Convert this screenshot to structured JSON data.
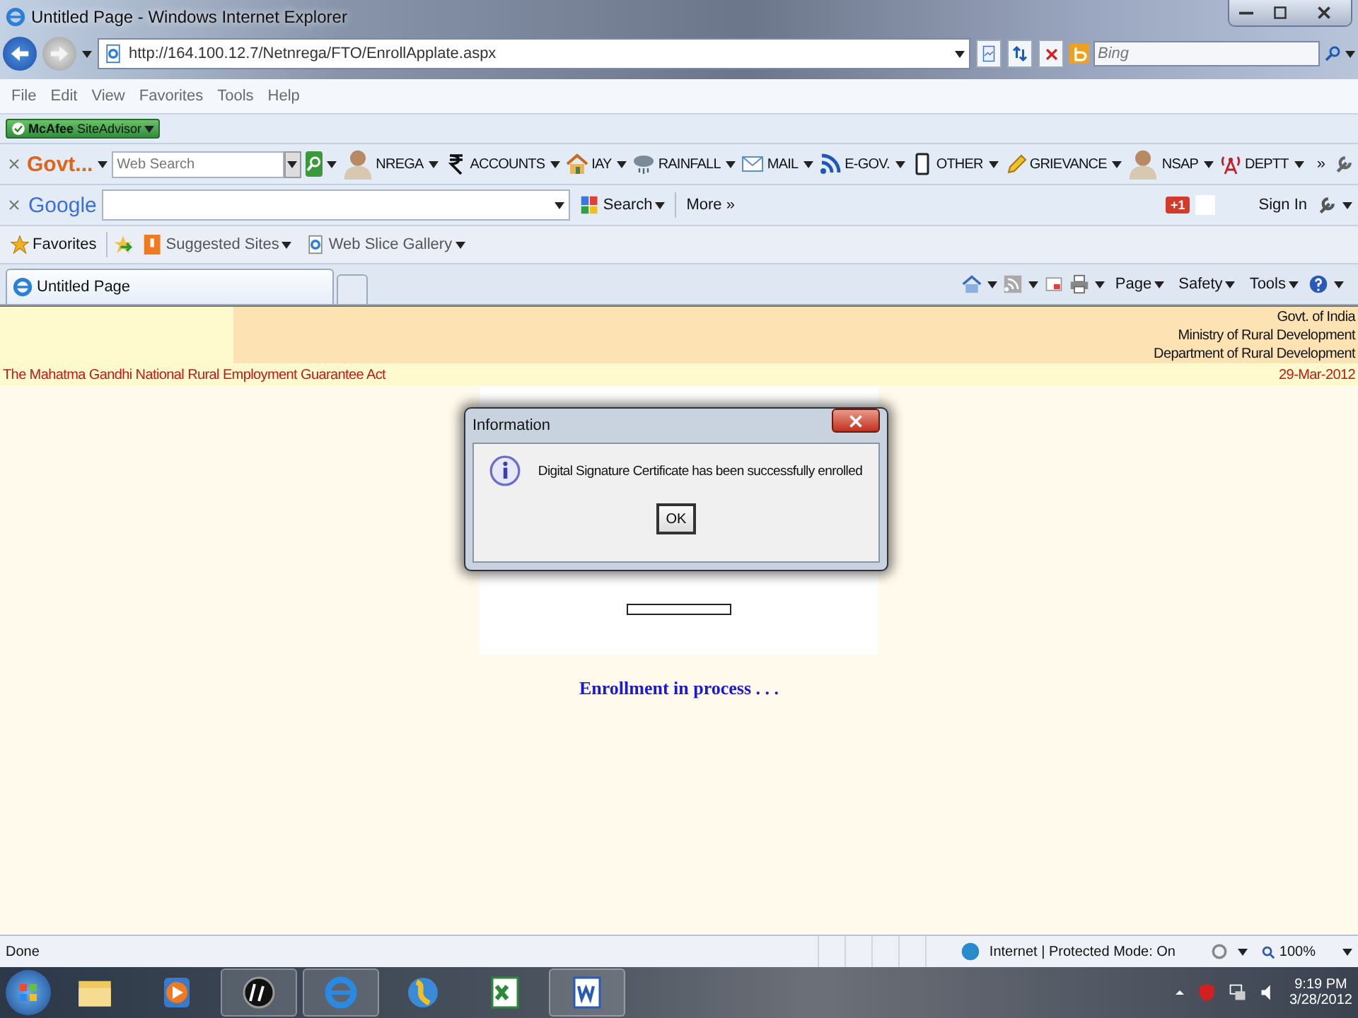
{
  "window": {
    "title": "Untitled Page - Windows Internet Explorer"
  },
  "address": {
    "url": "http://164.100.12.7/Netnrega/FTO/EnrollApplate.aspx",
    "search_placeholder": "Bing"
  },
  "menu": [
    "File",
    "Edit",
    "View",
    "Favorites",
    "Tools",
    "Help"
  ],
  "mcafee": {
    "label": "**McAfee** SiteAdvisor"
  },
  "govt_toolbar": {
    "name": "Govt...",
    "search_placeholder": "Web Search",
    "more": "»",
    "items": [
      {
        "label": "NREGA"
      },
      {
        "label": "ACCOUNTS"
      },
      {
        "label": "IAY"
      },
      {
        "label": "RAINFALL"
      },
      {
        "label": "MAIL"
      },
      {
        "label": "E-GOV."
      },
      {
        "label": "OTHER"
      },
      {
        "label": "GRIEVANCE"
      },
      {
        "label": "NSAP"
      },
      {
        "label": "DEPTT"
      }
    ]
  },
  "google_toolbar": {
    "logo": "Google",
    "search_button": "Search",
    "more": "More »",
    "plus_one": "+1",
    "sign_in": "Sign In"
  },
  "favorites_bar": {
    "label": "Favorites",
    "links": [
      "Suggested Sites",
      "Web Slice Gallery"
    ]
  },
  "tabs": [
    {
      "title": "Untitled Page",
      "selected": true
    }
  ],
  "command_bar": [
    "Page",
    "Safety",
    "Tools"
  ],
  "page": {
    "header_lines": [
      "Govt. of India",
      "Ministry of Rural Development",
      "Department of Rural Development"
    ],
    "act": "The Mahatma Gandhi National Rural Employment Guarantee Act",
    "date": "29-Mar-2012",
    "status": "Enrollment in process . . .",
    "dialog": {
      "title": "Information",
      "message": "Digital Signature Certificate has been successfully enrolled",
      "button": "OK"
    }
  },
  "status_bar": {
    "text": "Done",
    "zone": "Internet | Protected Mode: On",
    "zoom": "100%"
  },
  "taskbar": {
    "time": "9:19 PM",
    "date": "3/28/2012"
  }
}
